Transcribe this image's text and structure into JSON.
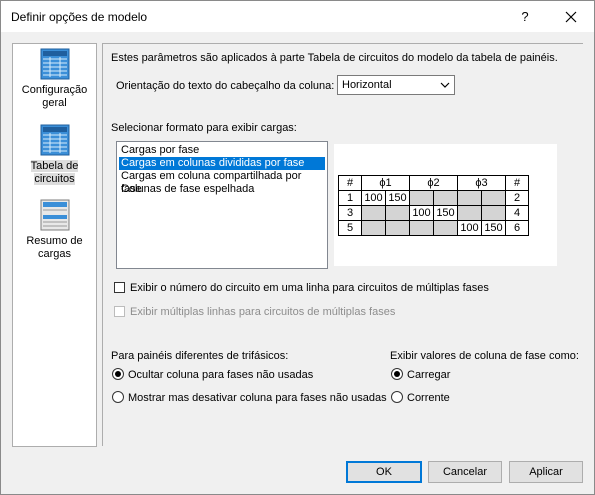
{
  "window": {
    "title": "Definir opções de modelo",
    "help_label": "?"
  },
  "sidebar": {
    "items": [
      {
        "label": "Configuração geral",
        "icon": "grid-table-icon"
      },
      {
        "label": "Tabela de circuitos",
        "icon": "grid-table-icon",
        "selected": true
      },
      {
        "label": "Resumo de cargas",
        "icon": "summary-table-icon"
      }
    ]
  },
  "content": {
    "description": "Estes parâmetros são aplicados à parte Tabela de circuitos do modelo da tabela de painéis.",
    "orientation_label": "Orientação do texto do cabeçalho da coluna:",
    "orientation_value": "Horizontal",
    "load_format_label": "Selecionar formato para exibir cargas:",
    "load_formats": [
      "Cargas por fase",
      "Cargas em colunas divididas por fase",
      "Cargas em coluna compartilhada por fase",
      "Colunas de fase espelhada"
    ],
    "selected_format": "Cargas em colunas divididas por fase",
    "preview": {
      "headers": [
        "#",
        "ϕ1",
        "ϕ2",
        "ϕ3",
        "#"
      ],
      "rows": [
        [
          "1",
          "100",
          "150",
          "",
          "",
          "",
          "",
          "2"
        ],
        [
          "3",
          "",
          "",
          "100",
          "150",
          "",
          "",
          "4"
        ],
        [
          "5",
          "",
          "",
          "",
          "",
          "100",
          "150",
          "6"
        ]
      ]
    },
    "checkbox_circuit_number": "Exibir o número do circuito em uma linha para circuitos de múltiplas fases",
    "checkbox_multiple_lines": "Exibir múltiplas linhas para circuitos de múltiplas fases",
    "non_three_phase_label": "Para painéis diferentes de trifásicos:",
    "non_three_phase_options": [
      "Ocultar coluna para fases não usadas",
      "Mostrar mas desativar coluna para fases não usadas"
    ],
    "phase_values_label": "Exibir valores de coluna de fase como:",
    "phase_values_options": [
      "Carregar",
      "Corrente"
    ]
  },
  "buttons": {
    "ok": "OK",
    "cancel": "Cancelar",
    "apply": "Aplicar"
  }
}
